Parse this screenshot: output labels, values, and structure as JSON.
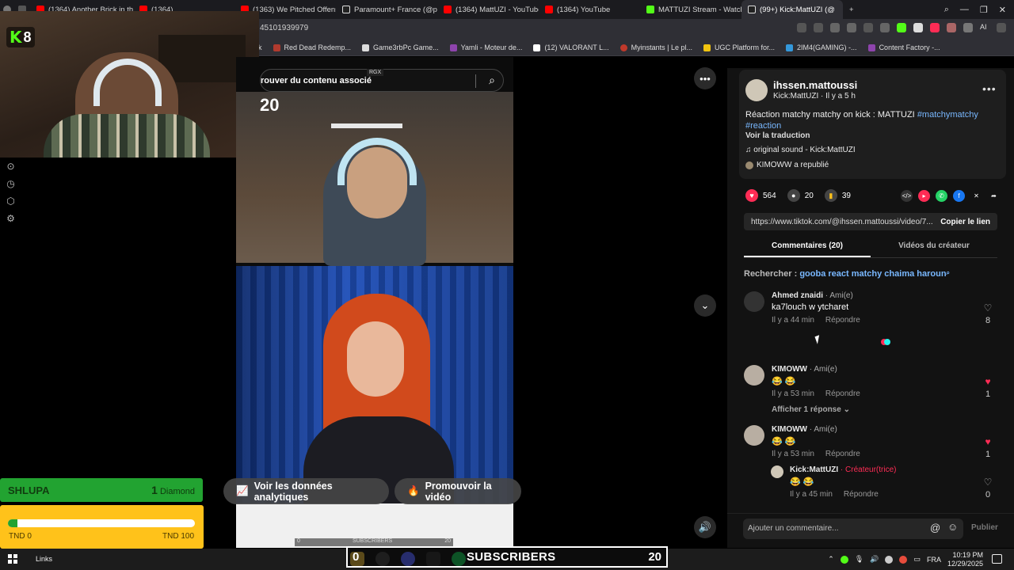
{
  "browser": {
    "tabs": [
      {
        "label": "(1364) Another Brick in the",
        "color": "#ff0000"
      },
      {
        "label": "(1364) ...",
        "color": "#ff0000"
      },
      {
        "label": "(1363) We Pitched Offens",
        "color": "#ff0000"
      },
      {
        "label": "Paramount+ France (@pa",
        "color": "#ffffff"
      },
      {
        "label": "(1364) MattUZI - YouTube",
        "color": "#ff0000"
      },
      {
        "label": "(1364) YouTube",
        "color": "#ff0000"
      },
      {
        "label": "MATTUZI Stream - Watch",
        "color": "#53fc18"
      },
      {
        "label": "(99+) Kick:MattUZI (@",
        "color": "#ffffff"
      }
    ],
    "url_fragment": "45101939979",
    "bookmarks": [
      {
        "label": "k",
        "color": "#888888"
      },
      {
        "label": "Red Dead Redemp...",
        "color": "#b03a2e"
      },
      {
        "label": "Game3rbPc Game...",
        "color": "#dddddd"
      },
      {
        "label": "Yamli - Moteur de...",
        "color": "#8e44ad"
      },
      {
        "label": "(12) VALORANT L...",
        "color": "#ffffff"
      },
      {
        "label": "Myinstants | Le pl...",
        "color": "#c0392b"
      },
      {
        "label": "UGC Platform for...",
        "color": "#f1c40f"
      },
      {
        "label": "2IM4(GAMING) -...",
        "color": "#3498db"
      },
      {
        "label": "Content Factory -...",
        "color": "#8e44ad"
      }
    ],
    "ai_label": "AI"
  },
  "overlay": {
    "kick_logo": "K",
    "viewer_count": "8",
    "goal_name": "SHLUPA",
    "goal_count": "1",
    "goal_unit": "Diamond",
    "goal_min": "TND 0",
    "goal_max": "TND 100",
    "goal_progress": 0.05,
    "subs_current": "0",
    "subs_label": "SUBSCRIBERS",
    "subs_target": "20"
  },
  "video": {
    "search_text": "rouver du contenu associé",
    "rgx_label": "RGX",
    "frame_number": "20",
    "analytics_button": "Voir les données analytiques",
    "promote_button": "Promouvoir la vidéo",
    "inner_sub_left": "0",
    "inner_sub_label": "SUBSCRIBERS",
    "inner_sub_right": "20"
  },
  "post": {
    "username": "ihssen.mattoussi",
    "subtitle": "Kick:MattUZI · Il y a 5 h",
    "description": "Réaction matchy matchy on kick : MATTUZI",
    "hashtag1": "#matchymatchy",
    "hashtag2": "#reaction",
    "translate": "Voir la traduction",
    "sound": "original sound - Kick:MattUZI",
    "repost": "KIMOWW a republié",
    "likes": "564",
    "comments": "20",
    "saves": "39",
    "link": "https://www.tiktok.com/@ihssen.mattoussi/video/7...",
    "copy_link": "Copier le lien",
    "tab_comments": "Commentaires (20)",
    "tab_creator": "Vidéos du créateur",
    "search_prefix": "Rechercher :",
    "search_query": "gooba react matchy chaima haroun"
  },
  "comments": [
    {
      "name": "Ahmed znaidi",
      "role": "· Ami(e)",
      "text": "ka7louch w ytcharet",
      "time": "Il y a 44 min",
      "reply": "Répondre",
      "likes": "8",
      "liked": false
    },
    {
      "name": "KIMOWW",
      "role": "· Ami(e)",
      "text": "😂 😂",
      "time": "Il y a 53 min",
      "reply": "Répondre",
      "likes": "1",
      "liked": true
    },
    {
      "name": "KIMOWW",
      "role": "· Ami(e)",
      "text": "😂 😂",
      "time": "Il y a 53 min",
      "reply": "Répondre",
      "likes": "1",
      "liked": true
    },
    {
      "name": "Kick:MattUZI",
      "role": "· Créateur(trice)",
      "text": "😂 😂",
      "time": "Il y a 45 min",
      "reply": "Répondre",
      "likes": "0",
      "liked": false
    }
  ],
  "show_replies": "Afficher 1 réponse",
  "compose": {
    "placeholder": "Ajouter un commentaire...",
    "publish": "Publier"
  },
  "taskbar": {
    "links": "Links",
    "lang": "FRA",
    "time": "10:19 PM",
    "date": "12/29/2025"
  }
}
